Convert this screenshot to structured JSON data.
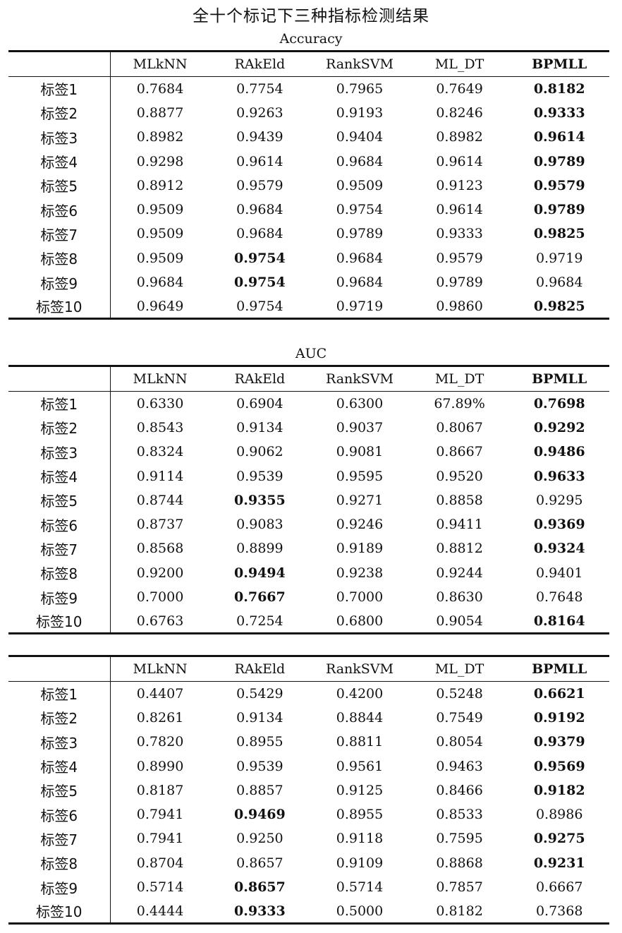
{
  "title": "全十个标记下三种指标检测结果",
  "columns": [
    "MLkNN",
    "RAkEld",
    "RankSVM",
    "ML_DT",
    "BPMLL"
  ],
  "bold_header_index": 4,
  "tables": [
    {
      "section_title": "Accuracy",
      "rows": [
        {
          "label": "标签1",
          "values": [
            "0.7684",
            "0.7754",
            "0.7965",
            "0.7649",
            "0.8182"
          ],
          "bold": 4
        },
        {
          "label": "标签2",
          "values": [
            "0.8877",
            "0.9263",
            "0.9193",
            "0.8246",
            "0.9333"
          ],
          "bold": 4
        },
        {
          "label": "标签3",
          "values": [
            "0.8982",
            "0.9439",
            "0.9404",
            "0.8982",
            "0.9614"
          ],
          "bold": 4
        },
        {
          "label": "标签4",
          "values": [
            "0.9298",
            "0.9614",
            "0.9684",
            "0.9614",
            "0.9789"
          ],
          "bold": 4
        },
        {
          "label": "标签5",
          "values": [
            "0.8912",
            "0.9579",
            "0.9509",
            "0.9123",
            "0.9579"
          ],
          "bold": 4
        },
        {
          "label": "标签6",
          "values": [
            "0.9509",
            "0.9684",
            "0.9754",
            "0.9614",
            "0.9789"
          ],
          "bold": 4
        },
        {
          "label": "标签7",
          "values": [
            "0.9509",
            "0.9684",
            "0.9789",
            "0.9333",
            "0.9825"
          ],
          "bold": 4
        },
        {
          "label": "标签8",
          "values": [
            "0.9509",
            "0.9754",
            "0.9684",
            "0.9579",
            "0.9719"
          ],
          "bold": 1
        },
        {
          "label": "标签9",
          "values": [
            "0.9684",
            "0.9754",
            "0.9684",
            "0.9789",
            "0.9684"
          ],
          "bold": 1
        },
        {
          "label": "标签10",
          "values": [
            "0.9649",
            "0.9754",
            "0.9719",
            "0.9860",
            "0.9825"
          ],
          "bold": 4
        }
      ]
    },
    {
      "section_title": "AUC",
      "rows": [
        {
          "label": "标签1",
          "values": [
            "0.6330",
            "0.6904",
            "0.6300",
            "67.89%",
            "0.7698"
          ],
          "bold": 4
        },
        {
          "label": "标签2",
          "values": [
            "0.8543",
            "0.9134",
            "0.9037",
            "0.8067",
            "0.9292"
          ],
          "bold": 4
        },
        {
          "label": "标签3",
          "values": [
            "0.8324",
            "0.9062",
            "0.9081",
            "0.8667",
            "0.9486"
          ],
          "bold": 4
        },
        {
          "label": "标签4",
          "values": [
            "0.9114",
            "0.9539",
            "0.9595",
            "0.9520",
            "0.9633"
          ],
          "bold": 4
        },
        {
          "label": "标签5",
          "values": [
            "0.8744",
            "0.9355",
            "0.9271",
            "0.8858",
            "0.9295"
          ],
          "bold": 1
        },
        {
          "label": "标签6",
          "values": [
            "0.8737",
            "0.9083",
            "0.9246",
            "0.9411",
            "0.9369"
          ],
          "bold": 4
        },
        {
          "label": "标签7",
          "values": [
            "0.8568",
            "0.8899",
            "0.9189",
            "0.8812",
            "0.9324"
          ],
          "bold": 4
        },
        {
          "label": "标签8",
          "values": [
            "0.9200",
            "0.9494",
            "0.9238",
            "0.9244",
            "0.9401"
          ],
          "bold": 1
        },
        {
          "label": "标签9",
          "values": [
            "0.7000",
            "0.7667",
            "0.7000",
            "0.8630",
            "0.7648"
          ],
          "bold": 1
        },
        {
          "label": "标签10",
          "values": [
            "0.6763",
            "0.7254",
            "0.6800",
            "0.9054",
            "0.8164"
          ],
          "bold": 4
        }
      ]
    },
    {
      "section_title": "",
      "rows": [
        {
          "label": "标签1",
          "values": [
            "0.4407",
            "0.5429",
            "0.4200",
            "0.5248",
            "0.6621"
          ],
          "bold": 4
        },
        {
          "label": "标签2",
          "values": [
            "0.8261",
            "0.9134",
            "0.8844",
            "0.7549",
            "0.9192"
          ],
          "bold": 4
        },
        {
          "label": "标签3",
          "values": [
            "0.7820",
            "0.8955",
            "0.8811",
            "0.8054",
            "0.9379"
          ],
          "bold": 4
        },
        {
          "label": "标签4",
          "values": [
            "0.8990",
            "0.9539",
            "0.9561",
            "0.9463",
            "0.9569"
          ],
          "bold": 4
        },
        {
          "label": "标签5",
          "values": [
            "0.8187",
            "0.8857",
            "0.9125",
            "0.8466",
            "0.9182"
          ],
          "bold": 4
        },
        {
          "label": "标签6",
          "values": [
            "0.7941",
            "0.9469",
            "0.8955",
            "0.8533",
            "0.8986"
          ],
          "bold": 1
        },
        {
          "label": "标签7",
          "values": [
            "0.7941",
            "0.9250",
            "0.9118",
            "0.7595",
            "0.9275"
          ],
          "bold": 4
        },
        {
          "label": "标签8",
          "values": [
            "0.8704",
            "0.8657",
            "0.9109",
            "0.8868",
            "0.9231"
          ],
          "bold": 4
        },
        {
          "label": "标签9",
          "values": [
            "0.5714",
            "0.8657",
            "0.5714",
            "0.7857",
            "0.6667"
          ],
          "bold": 1
        },
        {
          "label": "标签10",
          "values": [
            "0.4444",
            "0.9333",
            "0.5000",
            "0.8182",
            "0.7368"
          ],
          "bold": 1
        }
      ]
    }
  ]
}
